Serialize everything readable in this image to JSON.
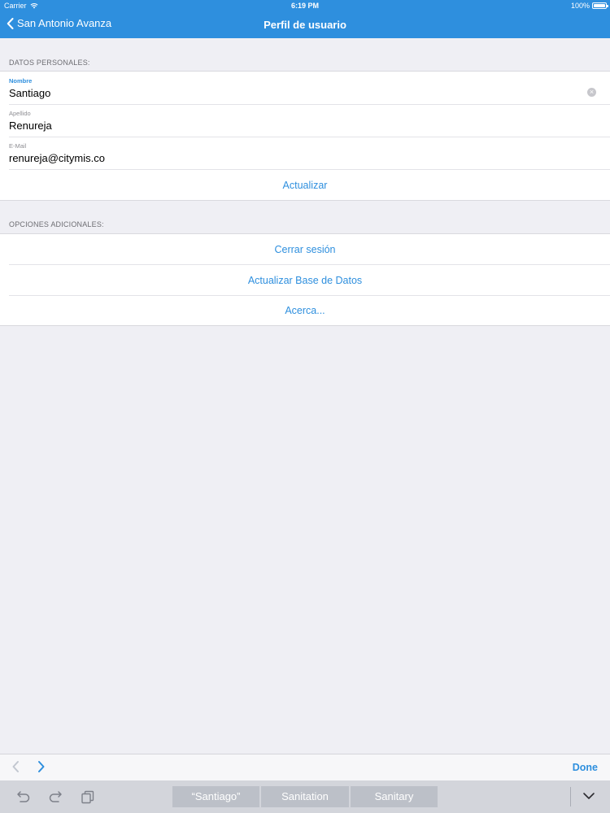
{
  "status_bar": {
    "carrier": "Carrier",
    "time": "6:19 PM",
    "battery": "100%"
  },
  "navbar": {
    "back_label": "San Antonio Avanza",
    "title": "Perfil de usuario"
  },
  "personal": {
    "header": "DATOS PERSONALES:",
    "fields": [
      {
        "label": "Nombre",
        "value": "Santiago"
      },
      {
        "label": "Apellido",
        "value": "Renureja"
      },
      {
        "label": "E-Mail",
        "value": "renureja@citymis.co"
      }
    ],
    "update_label": "Actualizar"
  },
  "additional": {
    "header": "OPCIONES ADICIONALES:",
    "items": [
      {
        "label": "Cerrar sesión"
      },
      {
        "label": "Actualizar Base de Datos"
      },
      {
        "label": "Acerca..."
      }
    ]
  },
  "keyboard_toolbar": {
    "done_label": "Done"
  },
  "predictions": [
    "“Santiago”",
    "Sanitation",
    "Sanitary"
  ],
  "colors": {
    "accent": "#2e8fde",
    "background": "#efeff4"
  }
}
